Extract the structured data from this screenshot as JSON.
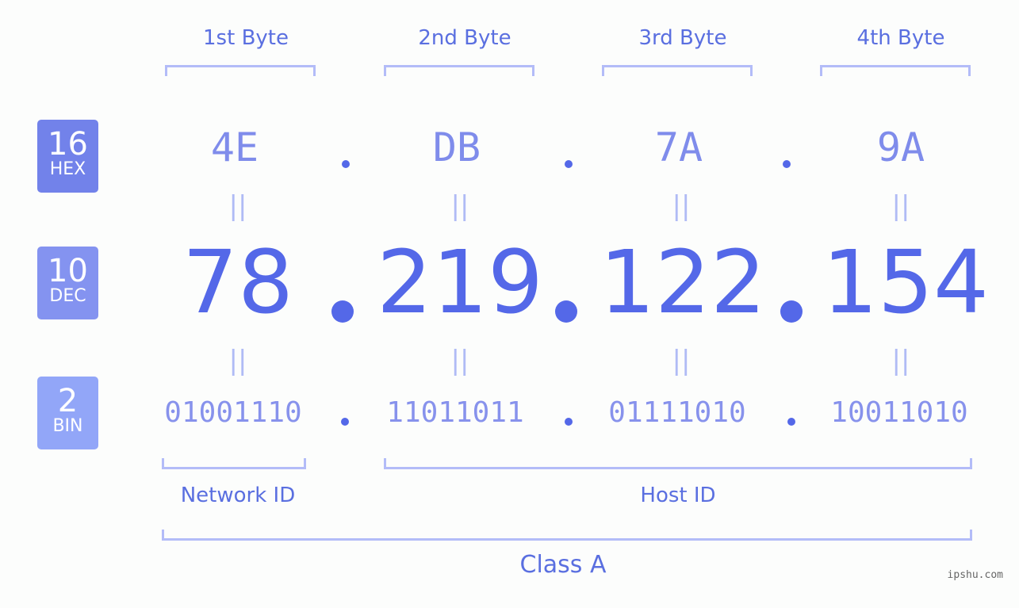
{
  "bytes": [
    {
      "label": "1st Byte",
      "hex": "4E",
      "dec": "78",
      "bin": "01001110"
    },
    {
      "label": "2nd Byte",
      "hex": "DB",
      "dec": "219",
      "bin": "11011011"
    },
    {
      "label": "3rd Byte",
      "hex": "7A",
      "dec": "122",
      "bin": "01111010"
    },
    {
      "label": "4th Byte",
      "hex": "9A",
      "dec": "154",
      "bin": "10011010"
    }
  ],
  "badges": {
    "hex": {
      "num": "16",
      "label": "HEX",
      "color": "#7282ea"
    },
    "dec": {
      "num": "10",
      "label": "DEC",
      "color": "#8493f0"
    },
    "bin": {
      "num": "2",
      "label": "BIN",
      "color": "#92a6f8"
    }
  },
  "equals_glyph": "||",
  "separator": ".",
  "segments": {
    "network": "Network ID",
    "host": "Host ID",
    "class": "Class A"
  },
  "watermark": "ipshu.com",
  "colors": {
    "accent": "#5468e8",
    "bracket": "#b3bcf8",
    "background": "#fcfdfc"
  }
}
